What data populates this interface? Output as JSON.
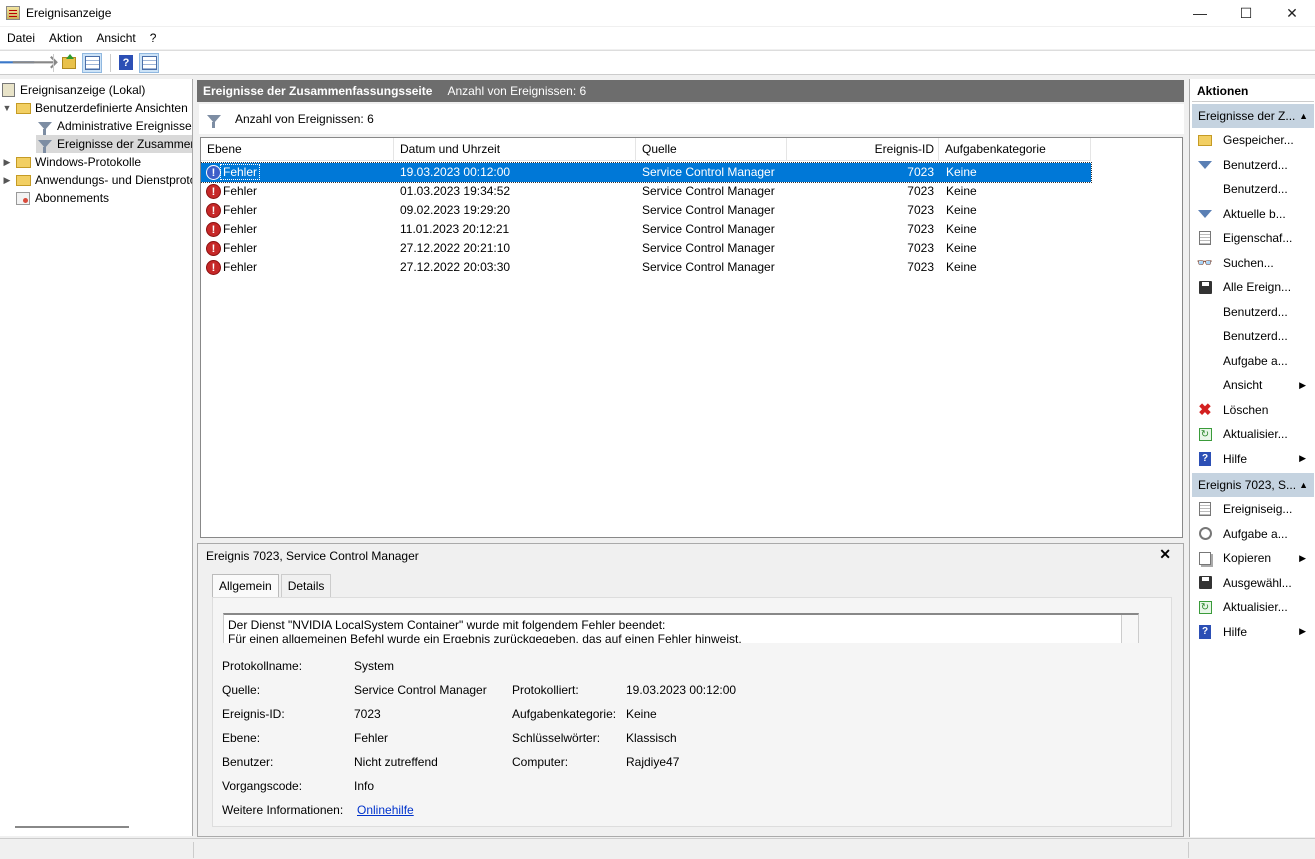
{
  "window": {
    "title": "Ereignisanzeige",
    "minimize": "—",
    "maximize": "☐",
    "close": "✕"
  },
  "menu": [
    "Datei",
    "Aktion",
    "Ansicht",
    "?"
  ],
  "tree": {
    "root": "Ereignisanzeige (Lokal)",
    "custom_views": "Benutzerdefinierte Ansichten",
    "admin_events": "Administrative Ereignisse",
    "summary_events": "Ereignisse der Zusammenfassungsseite",
    "windows_logs": "Windows-Protokolle",
    "app_service_logs": "Anwendungs- und Dienstprotokolle",
    "subscriptions": "Abonnements"
  },
  "main": {
    "header_title": "Ereignisse der Zusammenfassungsseite",
    "header_count": "Anzahl von Ereignissen: 6",
    "filter_count": "Anzahl von Ereignissen: 6",
    "columns": [
      "Ebene",
      "Datum und Uhrzeit",
      "Quelle",
      "Ereignis-ID",
      "Aufgabenkategorie"
    ],
    "rows": [
      {
        "level": "Fehler",
        "datetime": "19.03.2023 00:12:00",
        "source": "Service Control Manager",
        "id": "7023",
        "category": "Keine",
        "selected": true
      },
      {
        "level": "Fehler",
        "datetime": "01.03.2023 19:34:52",
        "source": "Service Control Manager",
        "id": "7023",
        "category": "Keine"
      },
      {
        "level": "Fehler",
        "datetime": "09.02.2023 19:29:20",
        "source": "Service Control Manager",
        "id": "7023",
        "category": "Keine"
      },
      {
        "level": "Fehler",
        "datetime": "11.01.2023 20:12:21",
        "source": "Service Control Manager",
        "id": "7023",
        "category": "Keine"
      },
      {
        "level": "Fehler",
        "datetime": "27.12.2022 20:21:10",
        "source": "Service Control Manager",
        "id": "7023",
        "category": "Keine"
      },
      {
        "level": "Fehler",
        "datetime": "27.12.2022 20:03:30",
        "source": "Service Control Manager",
        "id": "7023",
        "category": "Keine"
      }
    ]
  },
  "detail": {
    "title": "Ereignis 7023, Service Control Manager",
    "close": "✕",
    "tabs": [
      "Allgemein",
      "Details"
    ],
    "description_line1": "Der Dienst \"NVIDIA LocalSystem Container\" wurde mit folgendem Fehler beendet:",
    "description_line2": "Für einen allgemeinen Befehl wurde ein Ergebnis zurückgegeben, das auf einen Fehler hinweist.",
    "props": {
      "log_name_label": "Protokollname:",
      "log_name": "System",
      "source_label": "Quelle:",
      "source": "Service Control Manager",
      "logged_label": "Protokolliert:",
      "logged": "19.03.2023 00:12:00",
      "event_id_label": "Ereignis-ID:",
      "event_id": "7023",
      "task_cat_label": "Aufgabenkategorie:",
      "task_cat": "Keine",
      "level_label": "Ebene:",
      "level": "Fehler",
      "keywords_label": "Schlüsselwörter:",
      "keywords": "Klassisch",
      "user_label": "Benutzer:",
      "user": "Nicht zutreffend",
      "computer_label": "Computer:",
      "computer": "Rajdiye47",
      "opcode_label": "Vorgangscode:",
      "opcode": "Info",
      "more_info_label": "Weitere Informationen:",
      "more_info_link": "Onlinehilfe"
    }
  },
  "actions": {
    "header": "Aktionen",
    "section1": "Ereignisse der Z...",
    "section1_items": [
      {
        "label": "Gespeicher...",
        "icon": "folder-icon"
      },
      {
        "label": "Benutzerd...",
        "icon": "filter-icon"
      },
      {
        "label": "Benutzerd...",
        "icon": ""
      },
      {
        "label": "Aktuelle b...",
        "icon": "filter-icon"
      },
      {
        "label": "Eigenschaf...",
        "icon": "properties-icon"
      },
      {
        "label": "Suchen...",
        "icon": "binoculars-icon"
      },
      {
        "label": "Alle Ereign...",
        "icon": "save-icon"
      },
      {
        "label": "Benutzerd...",
        "icon": ""
      },
      {
        "label": "Benutzerd...",
        "icon": ""
      },
      {
        "label": "Aufgabe a...",
        "icon": ""
      },
      {
        "label": "Ansicht",
        "icon": "",
        "submenu": true
      },
      {
        "label": "Löschen",
        "icon": "delete-icon"
      },
      {
        "label": "Aktualisier...",
        "icon": "refresh-icon"
      },
      {
        "label": "Hilfe",
        "icon": "help-icon",
        "submenu": true
      }
    ],
    "section2": "Ereignis 7023, S...",
    "section2_items": [
      {
        "label": "Ereigniseig...",
        "icon": "properties-icon"
      },
      {
        "label": "Aufgabe a...",
        "icon": "task-icon"
      },
      {
        "label": "Kopieren",
        "icon": "copy-icon",
        "submenu": true
      },
      {
        "label": "Ausgewähl...",
        "icon": "save-icon"
      },
      {
        "label": "Aktualisier...",
        "icon": "refresh-icon"
      },
      {
        "label": "Hilfe",
        "icon": "help-icon",
        "submenu": true
      }
    ]
  }
}
